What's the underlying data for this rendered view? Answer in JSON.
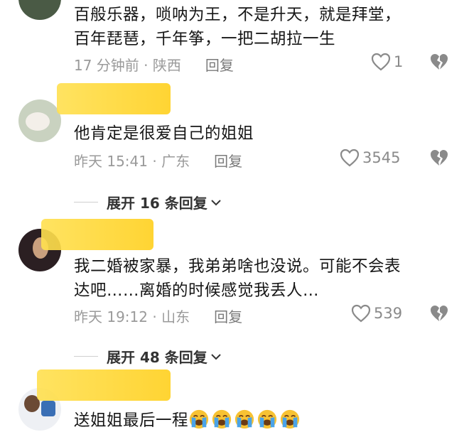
{
  "comments": [
    {
      "text_line1": "百般乐器，唢呐为王，不是升天，就是拜堂，",
      "text_line2": "百年琵琶，千年筝，一把二胡拉一生",
      "time_location": "17 分钟前 · 陕西",
      "reply_label": "回复",
      "likes": "1"
    },
    {
      "text": "他肯定是很爱自己的姐姐",
      "time_location": "昨天 15:41 · 广东",
      "reply_label": "回复",
      "likes": "3545",
      "expand_label": "展开 16 条回复"
    },
    {
      "text_line1": "我二婚被家暴，我弟弟啥也没说。可能不会表",
      "text_line2": "达吧……离婚的时候感觉我丢人…",
      "time_location": "昨天 19:12 · 山东",
      "reply_label": "回复",
      "likes": "539",
      "expand_label": "展开 48 条回复"
    },
    {
      "text": "送姐姐最后一程",
      "emoji": [
        "crying-face",
        "crying-face",
        "crying-face",
        "crying-face",
        "crying-face"
      ]
    }
  ],
  "colors": {
    "redaction": "#ffd93a",
    "meta_text": "#9a9a9a",
    "icon": "#8a8a8a"
  }
}
